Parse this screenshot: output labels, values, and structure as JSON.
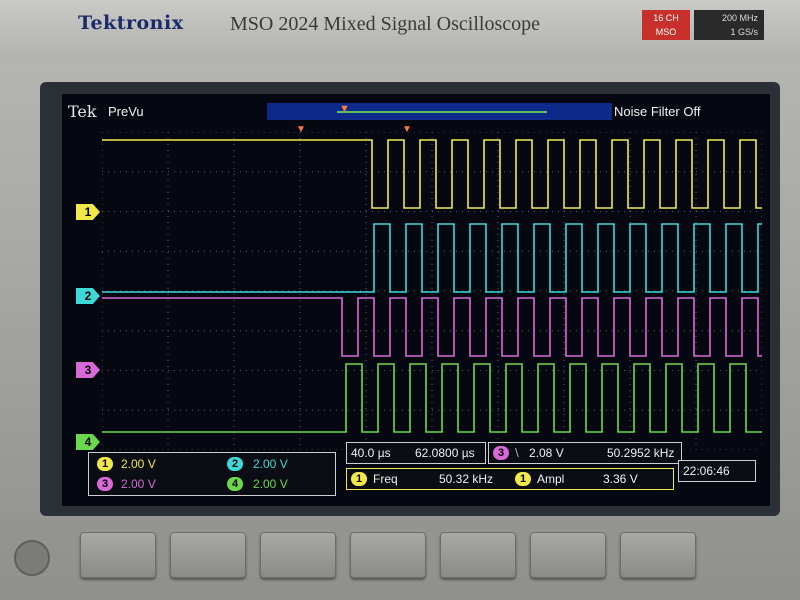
{
  "device": {
    "brand": "Tektronix",
    "model": "MSO 2024 Mixed Signal Oscilloscope",
    "badge_line1": "16 CH",
    "badge_line2": "MSO",
    "spec_line1": "200 MHz",
    "spec_line2": "1 GS/s"
  },
  "status": {
    "logo": "Tek",
    "mode": "PreVu",
    "noise_filter": "Noise Filter Off"
  },
  "channels": [
    {
      "id": "1",
      "color": "#f2e84a",
      "scale": "2.00 V"
    },
    {
      "id": "2",
      "color": "#3fd8d8",
      "scale": "2.00 V"
    },
    {
      "id": "3",
      "color": "#d86ad8",
      "scale": "2.00 V"
    },
    {
      "id": "4",
      "color": "#6ad84a",
      "scale": "2.00 V"
    }
  ],
  "timebase": {
    "scale": "40.0 µs",
    "position": "62.0800 µs"
  },
  "trigger": {
    "source": "3",
    "edge": "⧵",
    "level": "2.08 V",
    "frequency": "50.2952 kHz"
  },
  "measurements": [
    {
      "source": "1",
      "label": "Freq",
      "value": "50.32 kHz"
    },
    {
      "source": "1",
      "label": "Ampl",
      "value": "3.36 V"
    }
  ],
  "clock": "22:06:46",
  "softkeys": [
    "",
    "",
    "",
    "",
    "",
    "",
    ""
  ]
}
